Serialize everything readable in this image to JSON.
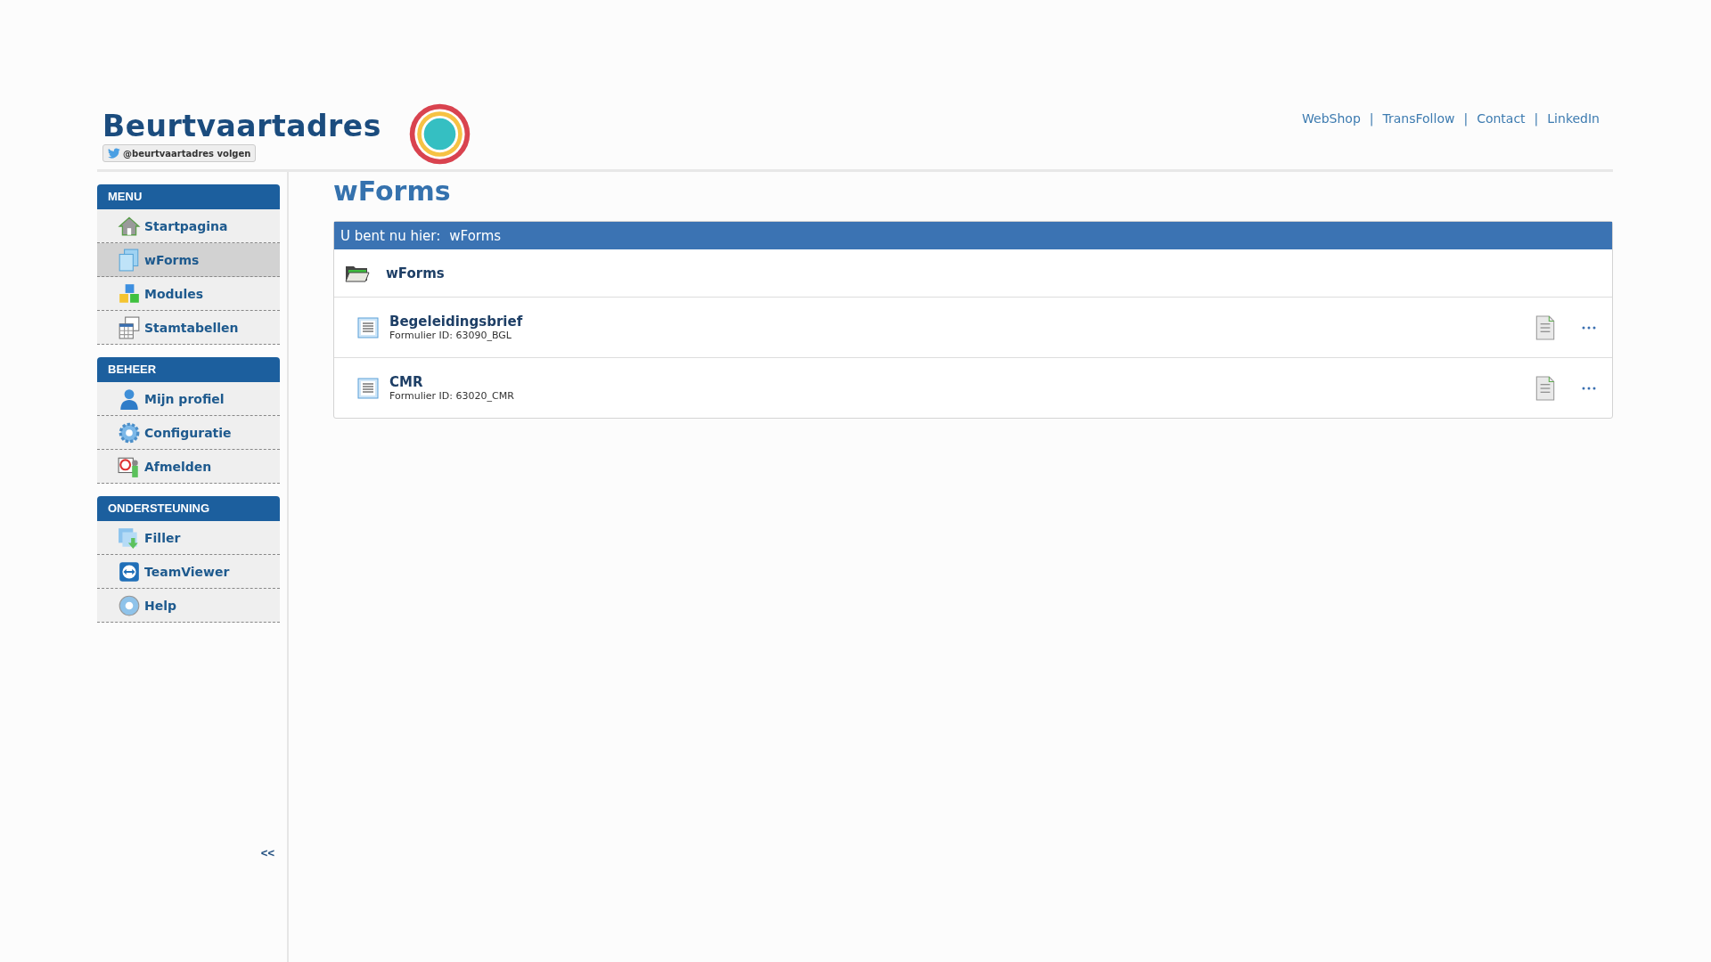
{
  "header": {
    "logo_text": "Beurtvaartadres",
    "follow_button": "@beurtvaartadres volgen",
    "links": [
      "WebShop",
      "TransFollow",
      "Contact",
      "LinkedIn"
    ],
    "separator": "|"
  },
  "sidebar": {
    "sections": [
      {
        "title": "MENU",
        "items": [
          {
            "label": "Startpagina",
            "selected": false
          },
          {
            "label": "wForms",
            "selected": true
          },
          {
            "label": "Modules",
            "selected": false
          },
          {
            "label": "Stamtabellen",
            "selected": false
          }
        ]
      },
      {
        "title": "BEHEER",
        "items": [
          {
            "label": "Mijn profiel",
            "selected": false
          },
          {
            "label": "Configuratie",
            "selected": false
          },
          {
            "label": "Afmelden",
            "selected": false
          }
        ]
      },
      {
        "title": "ONDERSTEUNING",
        "items": [
          {
            "label": "Filler",
            "selected": false
          },
          {
            "label": "TeamViewer",
            "selected": false
          },
          {
            "label": "Help",
            "selected": false
          }
        ]
      }
    ],
    "collapse": "<<"
  },
  "page_title": "wForms",
  "breadcrumb": {
    "prefix": "U bent nu hier:",
    "current": "wForms"
  },
  "folder": {
    "name": "wForms"
  },
  "forms": [
    {
      "name": "Begeleidingsbrief",
      "id": "Formulier ID: 63090_BGL"
    },
    {
      "name": "CMR",
      "id": "Formulier ID: 63020_CMR"
    }
  ]
}
